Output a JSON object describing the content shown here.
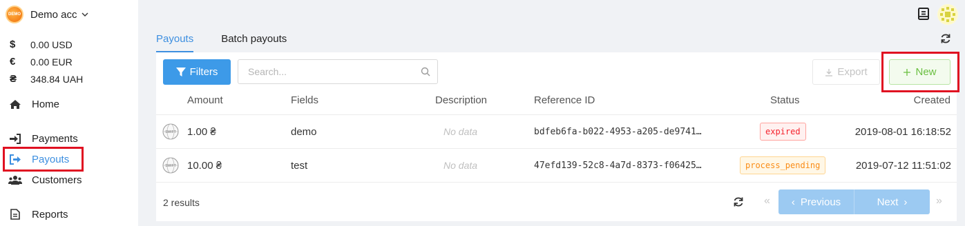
{
  "account": {
    "logo_text": "DEMO",
    "name": "Demo acc"
  },
  "balances": [
    {
      "symbol": "$",
      "value": "0.00 USD"
    },
    {
      "symbol": "€",
      "value": "0.00 EUR"
    },
    {
      "symbol": "₴",
      "value": "348.84 UAH"
    }
  ],
  "nav": {
    "home": "Home",
    "payments": "Payments",
    "payouts": "Payouts",
    "customers": "Customers",
    "reports": "Reports"
  },
  "tabs": [
    "Payouts",
    "Batch payouts"
  ],
  "toolbar": {
    "filters_label": "Filters",
    "search_placeholder": "Search...",
    "export_label": "Export",
    "new_label": "New"
  },
  "table": {
    "columns": [
      "Amount",
      "Fields",
      "Description",
      "Reference ID",
      "Status",
      "Created"
    ],
    "rows": [
      {
        "amount": "1.00 ₴",
        "fields": "demo",
        "description": "No data",
        "reference_id": "bdfeb6fa-b022-4953-a205-de9741…",
        "status": "expired",
        "created": "2019-08-01 16:18:52"
      },
      {
        "amount": "10.00 ₴",
        "fields": "test",
        "description": "No data",
        "reference_id": "47efd139-52c8-4a7d-8373-f06425…",
        "status": "process_pending",
        "created": "2019-07-12 11:51:02"
      }
    ]
  },
  "footer": {
    "results": "2 results",
    "previous": "Previous",
    "next": "Next",
    "first_symbol": "«",
    "last_symbol": "»",
    "prev_symbol": "‹",
    "next_symbol": "›"
  },
  "colors": {
    "accent": "#3d9ae8",
    "highlight": "#e01021",
    "new_green": "#6abf40",
    "expired_red": "#f5222d",
    "pending_orange": "#fa8c16"
  }
}
